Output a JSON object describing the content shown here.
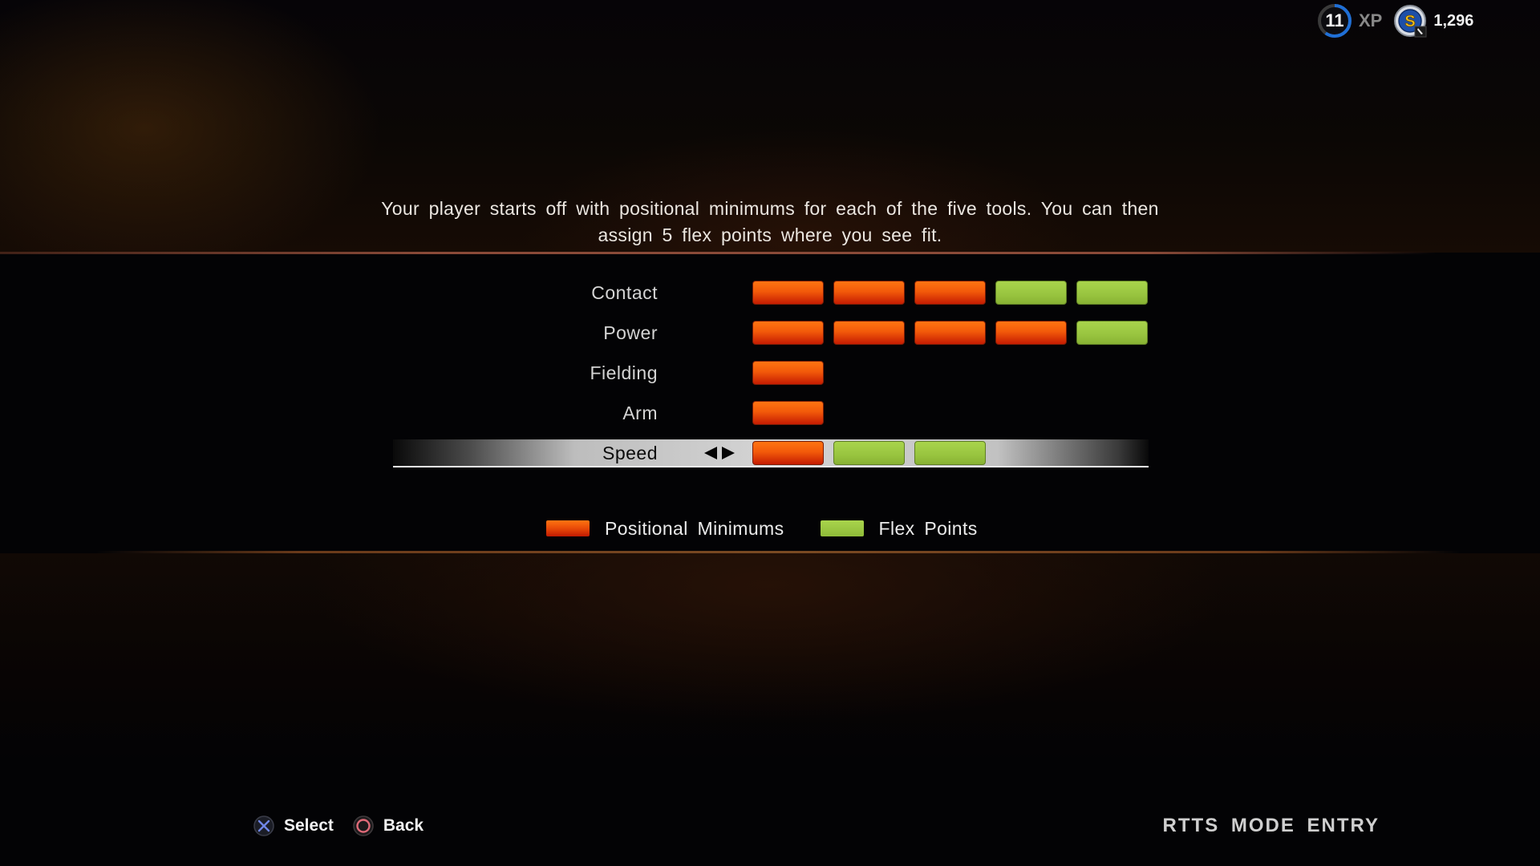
{
  "hud": {
    "xp_level": "11",
    "xp_label": "XP",
    "xp_progress": 0.6,
    "coin_icon": "stubs-coin-icon",
    "coin_letter": "S",
    "currency_amount": "1,296"
  },
  "intro_text": "Your player starts off with positional minimums for each of the five tools. You can then assign 5 flex points where you see fit.",
  "colors": {
    "positional_minimum": "#f25a0a",
    "flex_point": "#98c43f",
    "xp_ring": "#1f6fd6",
    "select_button": "#6f86e6",
    "back_button": "#e06a78"
  },
  "stats": [
    {
      "label": "Contact",
      "minimum": 3,
      "flex": 2,
      "selected": false
    },
    {
      "label": "Power",
      "minimum": 4,
      "flex": 1,
      "selected": false
    },
    {
      "label": "Fielding",
      "minimum": 1,
      "flex": 0,
      "selected": false
    },
    {
      "label": "Arm",
      "minimum": 1,
      "flex": 0,
      "selected": false
    },
    {
      "label": "Speed",
      "minimum": 1,
      "flex": 2,
      "selected": true
    }
  ],
  "legend": {
    "positional_minimums": "Positional Minimums",
    "flex_points": "Flex Points"
  },
  "footer": {
    "select_label": "Select",
    "select_icon": "cross-button-icon",
    "back_label": "Back",
    "back_icon": "circle-button-icon",
    "mode_title": "RTTS MODE ENTRY"
  }
}
